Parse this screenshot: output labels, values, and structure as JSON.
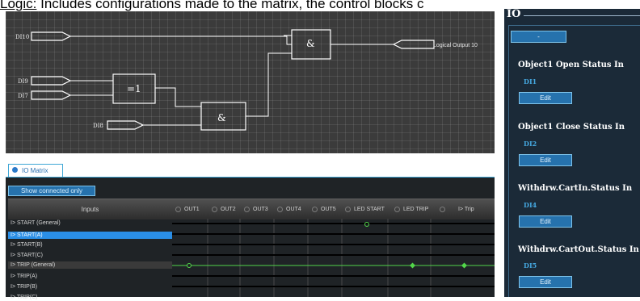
{
  "caption": {
    "underlined": "Logic:",
    "rest": " Includes configurations made to the matrix, the control blocks c"
  },
  "logic_diagram": {
    "inputs": [
      "DI10",
      "DI9",
      "DI7",
      "DI8"
    ],
    "gates": [
      "&",
      "=1",
      "&"
    ],
    "output": "Logical Output 10"
  },
  "io_matrix": {
    "tab_label": "IO Matrix",
    "show_connected_button": "Show connected only",
    "inputs_header": "Inputs",
    "columns": [
      "OUT1",
      "OUT2",
      "OUT3",
      "OUT4",
      "OUT5",
      "LED START",
      "LED TRIP",
      "I> Trip"
    ],
    "rows": [
      "I> START (General)",
      "I> START(A)",
      "I> START(B)",
      "I> START(C)",
      "I> TRIP (General)",
      "I> TRIP(A)",
      "I> TRIP(B)",
      "I> TRIP(C)"
    ],
    "selected_row": "I> START(A)",
    "connections": [
      {
        "row": "I> START (General)",
        "column": "LED START",
        "type": "open"
      },
      {
        "row": "I> TRIP (General)",
        "column": "OUT1",
        "type": "open"
      },
      {
        "row": "I> TRIP (General)",
        "column": "LED TRIP",
        "type": "filled"
      },
      {
        "row": "I> TRIP (General)",
        "column": "I> Trip",
        "type": "filled"
      }
    ],
    "colors": {
      "connection": "#52d64a",
      "selected": "#2a8ee6"
    }
  },
  "io_panel": {
    "title": "IO",
    "collapse_button": "-",
    "sections": [
      {
        "title": "Object1 Open Status In",
        "value": "DI1",
        "button": "Edit"
      },
      {
        "title": "Object1 Close Status In",
        "value": "DI2",
        "button": "Edit"
      },
      {
        "title": "Withdrw.CartIn.Status In",
        "value": "DI4",
        "button": "Edit"
      },
      {
        "title": "Withdrw.CartOut.Status In",
        "value": "DI5",
        "button": "Edit"
      }
    ]
  }
}
